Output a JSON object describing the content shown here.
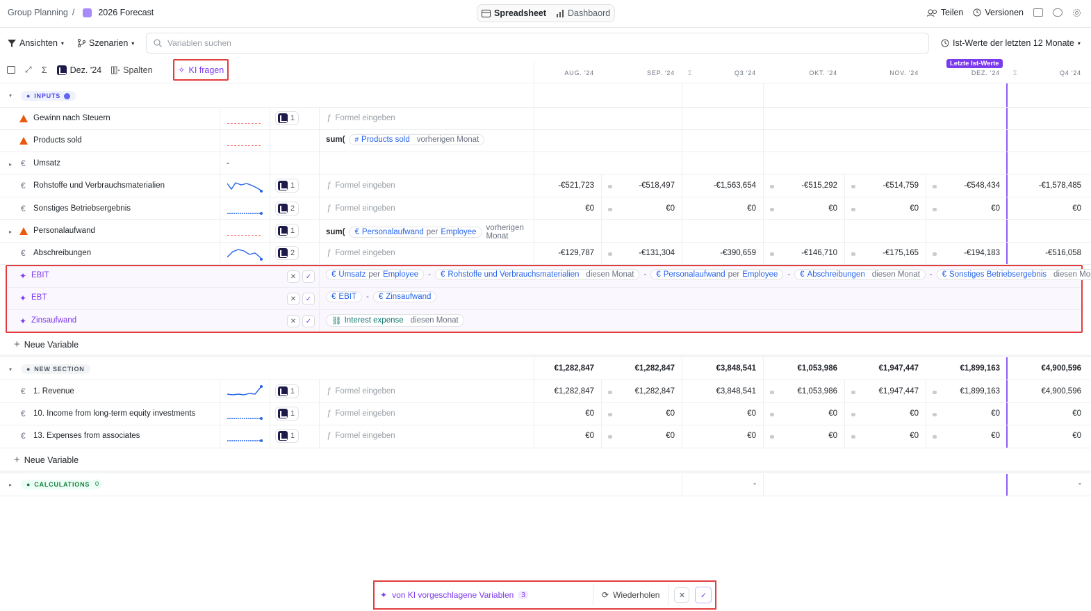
{
  "breadcrumb": {
    "parent": "Group Planning",
    "sep": "/",
    "current": "2026 Forecast"
  },
  "view_toggle": {
    "spreadsheet": "Spreadsheet",
    "dashboard": "Dashbaord"
  },
  "top_actions": {
    "share": "Teilen",
    "versions": "Versionen"
  },
  "toolbar": {
    "views": "Ansichten",
    "scenarios": "Szenarien",
    "search_placeholder": "Variablen suchen",
    "actuals": "Ist-Werte der letzten 12 Monate"
  },
  "toolbar2": {
    "date": "Dez. '24",
    "columns": "Spalten",
    "ask_ai": "KI fragen"
  },
  "columns": {
    "aug": "AUG. '24",
    "sep": "SEP. '24",
    "q3": "Q3 '24",
    "okt": "OKT. '24",
    "nov": "NOV. '24",
    "dez": "DEZ. '24",
    "q4": "Q4 '24",
    "last_actuals": "Letzte Ist-Werte",
    "sigma": "Σ"
  },
  "sections": {
    "inputs": "INPUTS",
    "new_section": "NEW SECTION",
    "calculations": "CALCULATIONS",
    "calc_count": "0"
  },
  "formula_placeholder": "Formel eingeben",
  "new_variable": "Neue Variable",
  "rows": {
    "gewinn": {
      "name": "Gewinn nach Steuern",
      "badge": "1"
    },
    "products": {
      "name": "Products sold",
      "f_sum": "sum(",
      "f_var": "Products sold",
      "f_mod": "vorherigen Monat"
    },
    "umsatz": {
      "name": "Umsatz",
      "dash": "-"
    },
    "rohstoffe": {
      "name": "Rohstoffe und Verbrauchsmaterialien",
      "badge": "1",
      "values": [
        "-€521,723",
        "-€518,497",
        "-€1,563,654",
        "-€515,292",
        "-€514,759",
        "-€548,434",
        "-€1,578,485"
      ]
    },
    "sonstiges": {
      "name": "Sonstiges Betriebsergebnis",
      "badge": "2",
      "values": [
        "€0",
        "€0",
        "€0",
        "€0",
        "€0",
        "€0",
        "€0"
      ]
    },
    "personal": {
      "name": "Personalaufwand",
      "badge": "1",
      "f_sum": "sum(",
      "f_var": "Personalaufwand",
      "f_per": "per",
      "f_var2": "Employee",
      "f_mod": "vorherigen Monat"
    },
    "abschreibungen": {
      "name": "Abschreibungen",
      "badge": "2",
      "values": [
        "-€129,787",
        "-€131,304",
        "-€390,659",
        "-€146,710",
        "-€175,165",
        "-€194,183",
        "-€516,058"
      ]
    },
    "ebit": {
      "name": "EBIT",
      "p1": "Umsatz",
      "per": "per",
      "emp": "Employee",
      "p2": "Rohstoffe und Verbrauchsmaterialien",
      "m": "diesen Monat",
      "p3": "Personalaufwand",
      "p4": "Abschreibungen",
      "p5": "Sonstiges Betriebsergebnis",
      "minus": "-"
    },
    "ebt": {
      "name": "EBT",
      "p1": "EBIT",
      "p2": "Zinsaufwand",
      "minus": "-"
    },
    "zins": {
      "name": "Zinsaufwand",
      "p1": "Interest expense",
      "m": "diesen Monat"
    },
    "ns_total": {
      "values": [
        "€1,282,847",
        "€1,282,847",
        "€3,848,541",
        "€1,053,986",
        "€1,947,447",
        "€1,899,163",
        "€4,900,596"
      ]
    },
    "revenue": {
      "name": "1. Revenue",
      "badge": "1",
      "values": [
        "€1,282,847",
        "€1,282,847",
        "€3,848,541",
        "€1,053,986",
        "€1,947,447",
        "€1,899,163",
        "€4,900,596"
      ]
    },
    "income10": {
      "name": "10. Income from long-term equity investments",
      "badge": "1",
      "values": [
        "€0",
        "€0",
        "€0",
        "€0",
        "€0",
        "€0",
        "€0"
      ]
    },
    "expenses13": {
      "name": "13. Expenses from associates",
      "badge": "1",
      "values": [
        "€0",
        "€0",
        "€0",
        "€0",
        "€0",
        "€0",
        "€0"
      ]
    },
    "calc": {
      "q3": "-",
      "q4": "-"
    }
  },
  "bottom_bar": {
    "label": "von KI vorgeschlagene Variablen",
    "count": "3",
    "retry": "Wiederholen"
  }
}
